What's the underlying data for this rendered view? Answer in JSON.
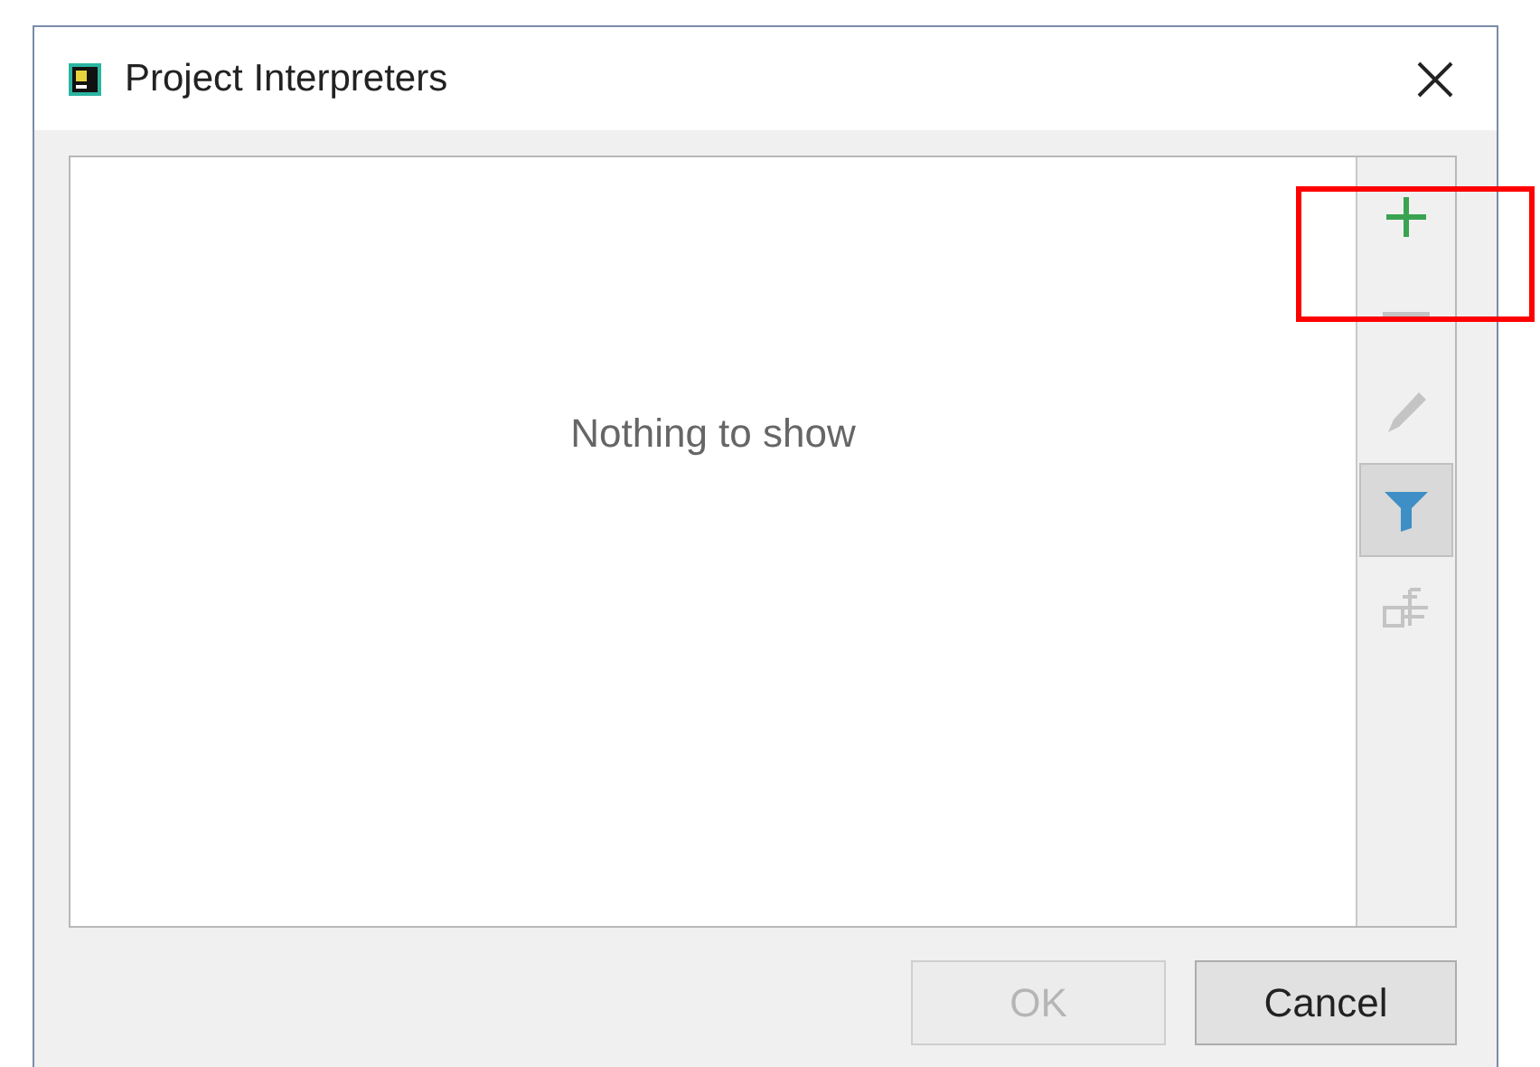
{
  "window": {
    "title": "Project Interpreters"
  },
  "list": {
    "empty_text": "Nothing to show"
  },
  "toolbar": [
    {
      "kind": "add",
      "disabled": false,
      "selected": false
    },
    {
      "kind": "remove",
      "disabled": true,
      "selected": false
    },
    {
      "kind": "edit",
      "disabled": true,
      "selected": false
    },
    {
      "kind": "filter",
      "disabled": false,
      "selected": true
    },
    {
      "kind": "tree",
      "disabled": true,
      "selected": false
    }
  ],
  "buttons": [
    {
      "label": "OK",
      "disabled": true
    },
    {
      "label": "Cancel",
      "disabled": false
    }
  ],
  "highlight": {
    "shown": true
  }
}
